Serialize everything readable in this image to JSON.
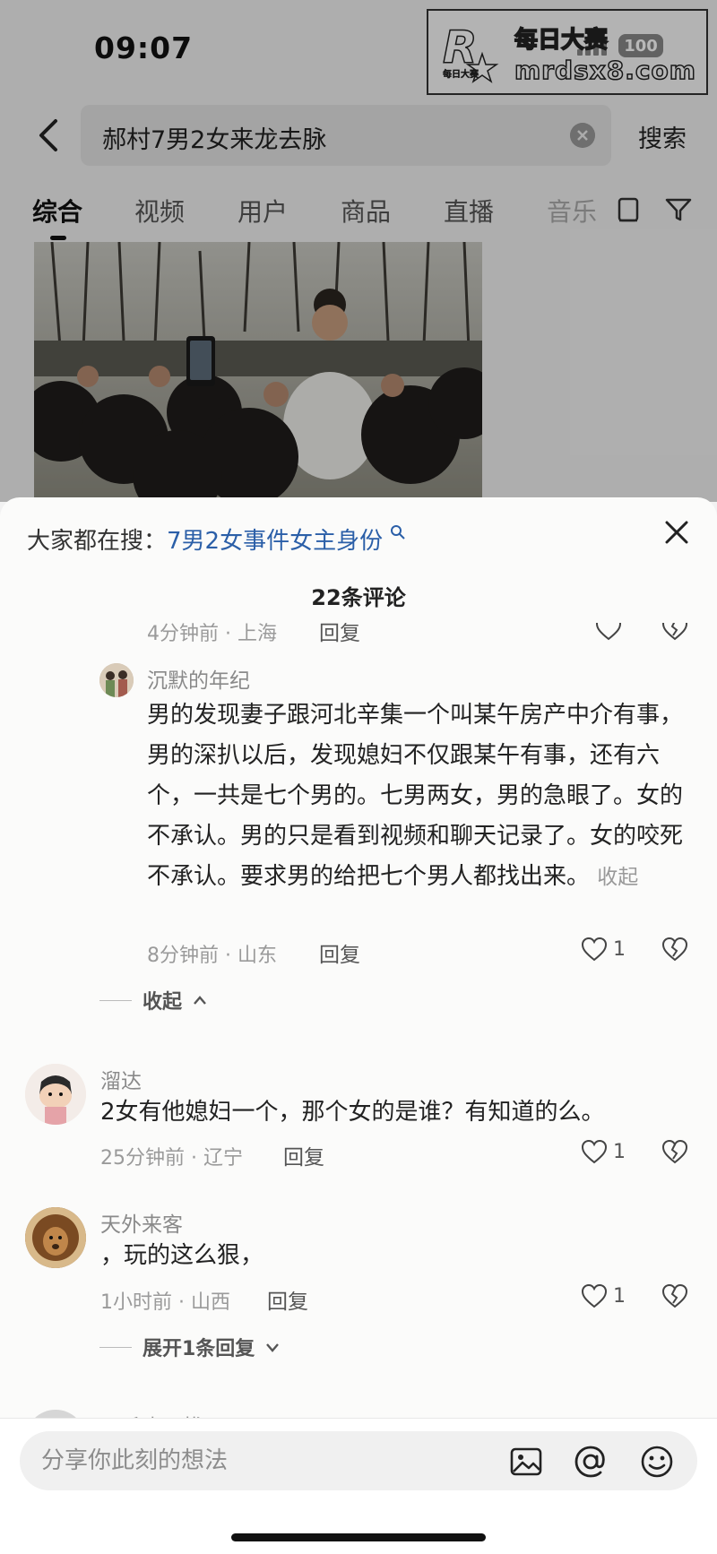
{
  "status_bar": {
    "time": "09:07",
    "battery": "100"
  },
  "watermark": {
    "logo_letter": "R",
    "logo_caption": "每日大赛",
    "title": "每日大赛",
    "url": "mrdsx8.com"
  },
  "search": {
    "query": "郝村7男2女来龙去脉",
    "button_label": "搜索"
  },
  "tabs": [
    {
      "label": "综合",
      "active": true
    },
    {
      "label": "视频"
    },
    {
      "label": "用户"
    },
    {
      "label": "商品"
    },
    {
      "label": "直播"
    },
    {
      "label": "音乐"
    }
  ],
  "sheet": {
    "hot_search_prefix": "大家都在搜：",
    "hot_search_link": "7男2女事件女主身份",
    "comment_count_label": "22条评论",
    "clipped_meta": "4分钟前 · 上海",
    "clipped_reply": "回复"
  },
  "comments": [
    {
      "name": "沉默的年纪",
      "text": "男的发现妻子跟河北辛集一个叫某午房产中介有事，男的深扒以后，发现媳妇不仅跟某午有事，还有六个，一共是七个男的。七男两女，男的急眼了。女的不承认。男的只是看到视频和聊天记录了。女的咬死不承认。要求男的给把七个男人都找出来。",
      "collapse_inline": "收起",
      "meta": "8分钟前 · 山东",
      "reply": "回复",
      "likes": "1",
      "fold_label": "收起"
    },
    {
      "name": "溜达",
      "text": "2女有他媳妇一个，那个女的是谁？有知道的么。",
      "meta": "25分钟前 · 辽宁",
      "reply": "回复",
      "likes": "1"
    },
    {
      "name": "天外来客",
      "text": "，玩的这么狠，",
      "meta": "1小时前 · 山西",
      "reply": "回复",
      "likes": "1",
      "fold_label": "展开1条回复"
    },
    {
      "name": "一毛也不拔"
    }
  ],
  "input": {
    "placeholder": "分享你此刻的想法"
  }
}
